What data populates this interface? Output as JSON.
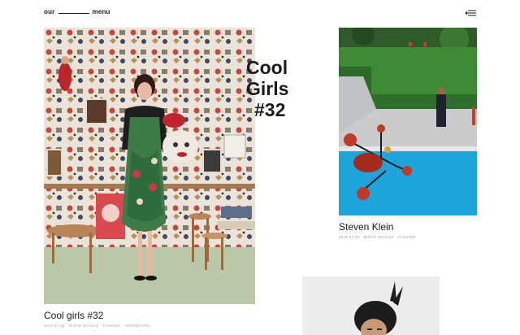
{
  "header": {
    "brand_left": "our",
    "brand_right": "menu",
    "menu_icon": "hamburger-arrow-icon"
  },
  "featured": {
    "overlay_line1": "Cool",
    "overlay_line2": "Girls",
    "overlay_line3": "#32",
    "title": "Cool girls #32",
    "meta": [
      "2015.07.23",
      "Marie Schulz",
      "Fashion",
      "Inspiration"
    ]
  },
  "secondary": {
    "title": "Steven Klein",
    "meta": [
      "2015.07.23",
      "Marie Schulz",
      "Fashion"
    ]
  },
  "colors": {
    "text": "#1a1a1a",
    "meta": "#a0a0a0",
    "pool": "#1ea4d8",
    "lawn": "#3f8a35"
  }
}
